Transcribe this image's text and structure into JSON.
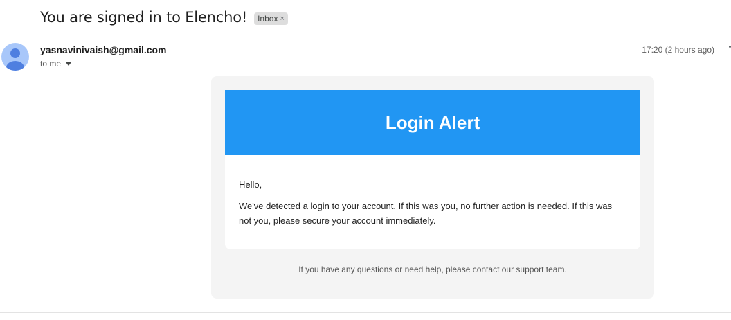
{
  "email": {
    "subject": "You are signed in to Elencho!",
    "label": "Inbox",
    "label_remove": "×",
    "sender": "yasnavinivaish@gmail.com",
    "recipient": "to me",
    "timestamp": "17:20 (2 hours ago)"
  },
  "content": {
    "header_title": "Login Alert",
    "header_color": "#2196f3",
    "greeting": "Hello,",
    "message": "We've detected a login to your account. If this was you, no further action is needed. If this was not you, please secure your account immediately.",
    "footer": "If you have any questions or need help, please contact our support team."
  },
  "icons": {
    "avatar": "default-person-avatar-icon",
    "recipient_toggle": "caret-down-icon",
    "more": "more-options-icon"
  }
}
